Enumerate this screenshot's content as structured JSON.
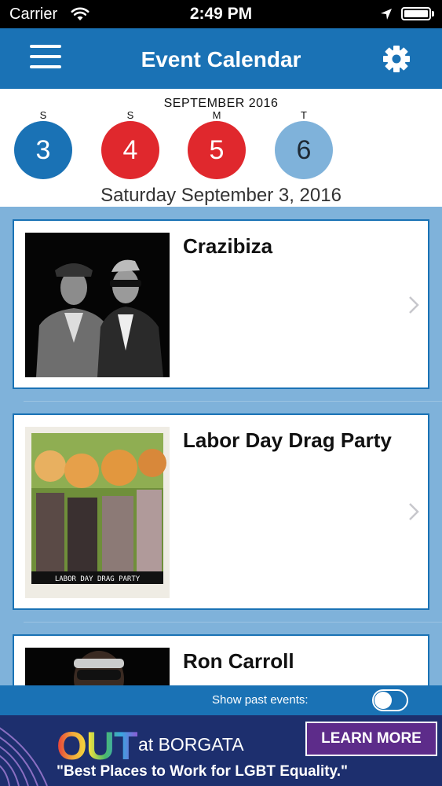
{
  "status_bar": {
    "carrier": "Carrier",
    "time": "2:49 PM"
  },
  "header": {
    "title": "Event Calendar"
  },
  "calendar": {
    "month_label": "SEPTEMBER 2016",
    "days": [
      {
        "dow": "S",
        "day": "3",
        "color": "#1a72b5",
        "text_color": "#ffffff"
      },
      {
        "dow": "S",
        "day": "4",
        "color": "#e0282d",
        "text_color": "#ffffff"
      },
      {
        "dow": "M",
        "day": "5",
        "color": "#e0282d",
        "text_color": "#ffffff"
      },
      {
        "dow": "T",
        "day": "6",
        "color": "#7fb2da",
        "text_color": "#1e2a36"
      }
    ],
    "selected_date": "Saturday September 3, 2016"
  },
  "events": [
    {
      "name": "Crazibiza",
      "image": "dj-duo-photo"
    },
    {
      "name": "Labor Day Drag Party",
      "image": "drag-queens-photo",
      "image_caption": "LABOR DAY DRAG PARTY"
    },
    {
      "name": "Ron Carroll",
      "image": "dj-portrait-photo"
    }
  ],
  "footer": {
    "show_past_label": "Show past events:",
    "show_past_enabled": false
  },
  "ad": {
    "brand": "OUT",
    "brand_suffix": "at BORGATA",
    "tagline": "\"Best Places to Work for LGBT Equality.\"",
    "cta": "LEARN MORE"
  },
  "colors": {
    "primary": "#1a72b5",
    "list_bg": "#7fb2da",
    "weekend": "#e0282d",
    "selected": "#1a72b5"
  }
}
